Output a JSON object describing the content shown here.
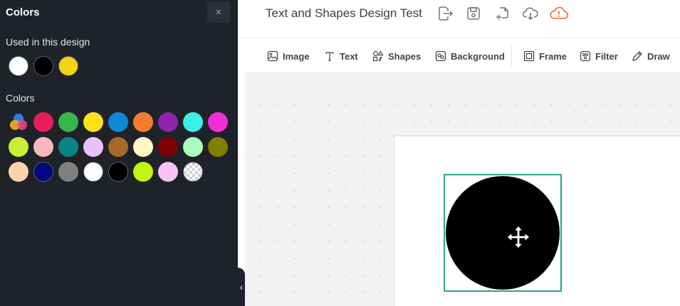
{
  "sidebar": {
    "title": "Colors",
    "close_label": "×",
    "used_label": "Used in this design",
    "used_colors": [
      "#ffffff",
      "#000000",
      "#f5d312"
    ],
    "colors_label": "Colors",
    "palette_rows": [
      [
        "picker",
        "#e81e5a",
        "#3bb54a",
        "#fde11a",
        "#0d88d6",
        "#f47c30",
        "#8e24aa",
        "#3cefe6",
        "#f12fd9"
      ],
      [
        "#c9ee3a",
        "#f7b8ba",
        "#0b8484",
        "#e8c1f9",
        "#a46b27",
        "#fffac2",
        "#7d0103",
        "#a9fcbd",
        "#808000"
      ],
      [
        "#fed3ac",
        "#000980",
        "#808080",
        "#ffffff",
        "#000000",
        "#c1f40e",
        "#f8c3f3",
        "transparent"
      ]
    ],
    "collapse_icon": "chevron-left-icon"
  },
  "header": {
    "doc_title": "Text and Shapes Design Test",
    "icons": [
      "export-icon",
      "save-icon",
      "duplicate-icon",
      "download-icon",
      "cloud-warning-icon"
    ],
    "warning_color": "#f26b2a"
  },
  "toolbar": {
    "image": "Image",
    "text": "Text",
    "shapes": "Shapes",
    "background": "Background",
    "frame": "Frame",
    "filter": "Filter",
    "draw": "Draw"
  },
  "canvas": {
    "shape": "circle",
    "shape_color": "#000000",
    "selection_color": "#2ea77f"
  }
}
